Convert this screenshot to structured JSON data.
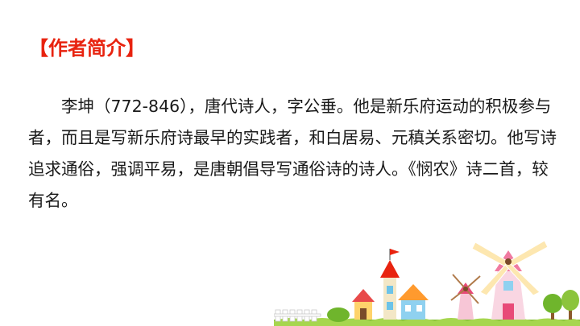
{
  "heading": "【作者简介】",
  "body": "李坤（772-846），唐代诗人，字公垂。他是新乐府运动的积极参与者，而且是写新乐府诗最早的实践者，和白居易、元稹关系密切。他写诗追求通俗，强调平易，是唐朝倡导写通俗诗的诗人。《悯农》诗二首，较有名。",
  "colors": {
    "heading": "#e8230f",
    "text": "#1a1a1a",
    "grass": "#8cc43c",
    "windmill": "#f07aa0"
  },
  "decoration": "windmill-village-illustration"
}
